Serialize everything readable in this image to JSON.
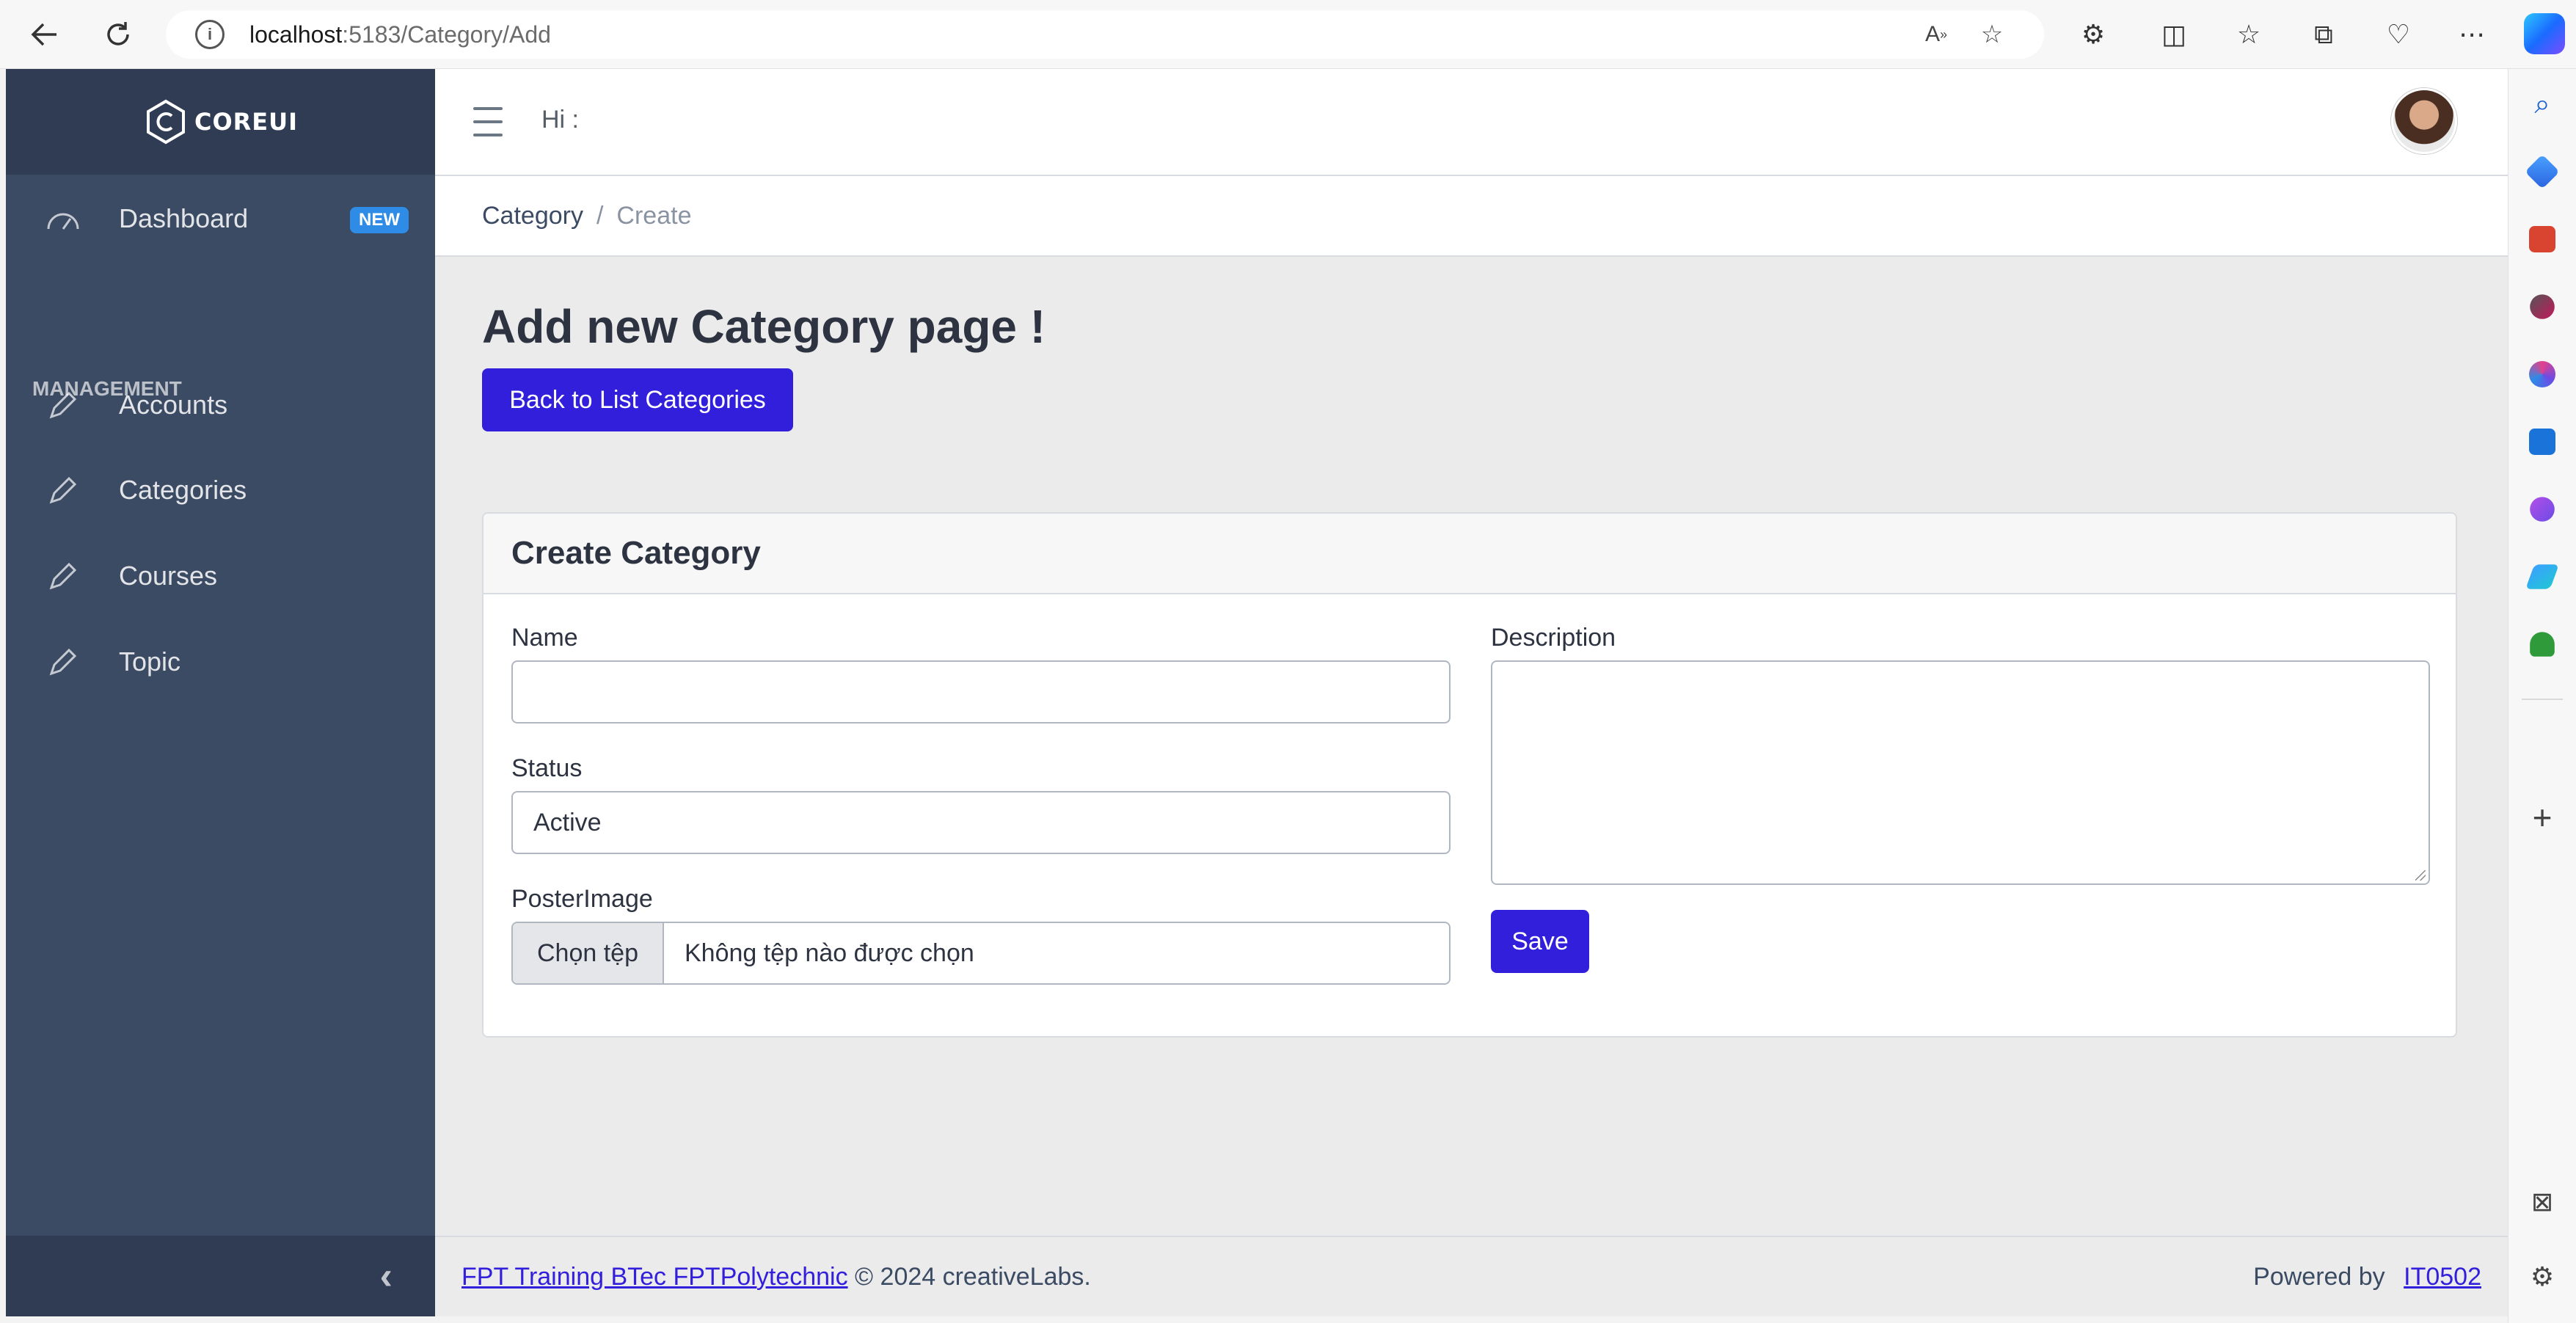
{
  "browser": {
    "url_host": "localhost",
    "url_path": ":5183/Category/Add"
  },
  "sidebar": {
    "brand": "COREUI",
    "dashboard": {
      "label": "Dashboard",
      "badge": "NEW"
    },
    "section_title": "MANAGEMENT",
    "items": [
      {
        "label": "Accounts"
      },
      {
        "label": "Categories"
      },
      {
        "label": "Courses"
      },
      {
        "label": "Topic"
      }
    ]
  },
  "header": {
    "greeting": "Hi :"
  },
  "breadcrumb": {
    "parent": "Category",
    "separator": "/",
    "current": "Create"
  },
  "page": {
    "title": "Add new Category page !",
    "back_button": "Back to List Categories"
  },
  "card": {
    "title": "Create Category",
    "name_label": "Name",
    "name_value": "",
    "status_label": "Status",
    "status_value": "Active",
    "poster_label": "PosterImage",
    "file_button": "Chọn tệp",
    "file_status": "Không tệp nào được chọn",
    "description_label": "Description",
    "save_button": "Save"
  },
  "footer": {
    "left_link": "FPT Training BTec FPTPolytechnic",
    "left_text": "© 2024 creativeLabs.",
    "right_text": "Powered by",
    "right_link": "IT0502"
  },
  "colors": {
    "primary": "#321fdb",
    "sidebar_bg": "#3c4b64",
    "sidebar_dark": "#303c54",
    "badge": "#2e8be6"
  }
}
